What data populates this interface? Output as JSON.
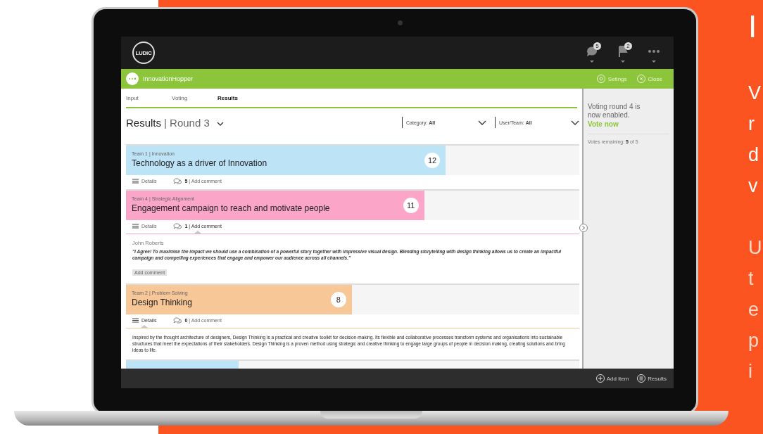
{
  "app": {
    "logo": "LUDIC",
    "notifications": [
      {
        "kind": "chat",
        "count": "5"
      },
      {
        "kind": "flag",
        "count": "2"
      },
      {
        "kind": "more"
      }
    ],
    "workspace": {
      "name": "InnovationHopper"
    },
    "header_actions": [
      {
        "kind": "settings",
        "label": "Setings"
      },
      {
        "kind": "close",
        "label": "Close"
      }
    ],
    "tabs": [
      {
        "label": "Input",
        "selected": false
      },
      {
        "label": "Voting",
        "selected": false
      },
      {
        "label": "Results",
        "selected": true
      }
    ],
    "heading": "Results",
    "round": "| Round 3",
    "filters": [
      "Category: **All**",
      "User/Team: **All**"
    ],
    "items": [
      {
        "tag": "Team 1 | Innovation",
        "title": "Technology as a driver of Innovation",
        "score": "12",
        "color": "#bde3f7",
        "level": 0.705,
        "details_label": "Details",
        "comment_label": "**5** | Add comment",
        "comments_open": false,
        "details_open": false
      },
      {
        "tag": "Team 4 | Strategic Alignment",
        "title": "Engagement campaign to reach and motivate people",
        "score": "11",
        "color": "#fba6c9",
        "level": 0.658,
        "details_label": "Details",
        "comment_label": "**1** | Add comment",
        "comments_open": true,
        "details_open": false,
        "comments": [
          {
            "author": "John Roberts",
            "text": "\"I Agree! To maximise the impact we should use a combination of a powerful story together with impressive visual design. Blending storytelling with design thinking allows us to create an impactful campaign and compelling experiences that engage and empower our audience across all channels.\""
          }
        ],
        "add_comment_button": "Add comment"
      },
      {
        "tag": "Team 2 | Problem Solving",
        "title": "Design Thinking",
        "score": "8",
        "color": "#f8c797",
        "level": 0.498,
        "details_label": "Details",
        "comment_label": "**0** | Add comment",
        "comments_open": false,
        "details_open": true,
        "details": "Inspired by the thought architecture of designers, Design Thinking is a practical and creative toolkit for decision-making. Its flexible and collaborative processes transform systems and organisations into sustainable structures that meet the expectations of their stakeholders. Design Thinking is a proven method using strategic and creative thinking to engage large groups of people in decision making, creating solutions and bring ideas to life."
      },
      {
        "color": "#bde3f7",
        "level": 0.248
      }
    ],
    "sidebar": {
      "message": "Voting round 4 is now enabled.",
      "link": "Vote now",
      "remaining": "Votes remaining: **5** of 5"
    },
    "footer_actions": [
      {
        "kind": "add",
        "label": "Add item"
      },
      {
        "kind": "results",
        "label": "Results"
      }
    ]
  },
  "promo": {
    "heading": "I",
    "paragraph_1": [
      "V",
      "r",
      "d",
      "v"
    ],
    "paragraph_2": [
      "U",
      "t",
      "e",
      "p",
      "i"
    ]
  }
}
